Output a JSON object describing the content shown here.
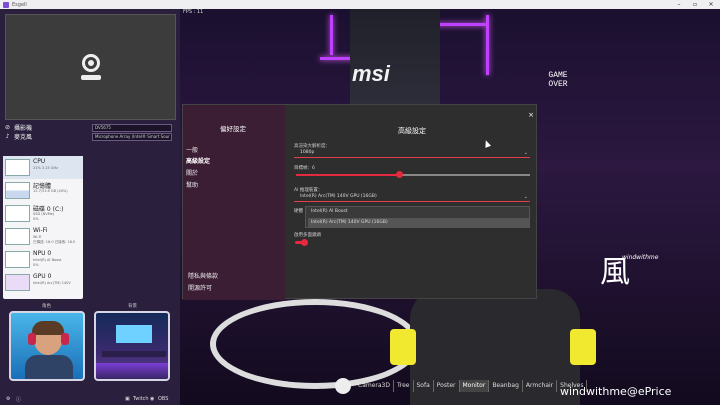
{
  "window": {
    "title": "Esgell"
  },
  "left_panel": {
    "camera": {
      "label": "攝影機"
    },
    "microphone": {
      "label": "麥克風",
      "device": "Microphone Array (Intel® Smart Sour"
    },
    "camera_device": "DV5675",
    "performance": [
      {
        "name": "CPU",
        "sub": "21% 3.15 GHz",
        "sub2": ""
      },
      {
        "name": "記憶體",
        "sub": "12.7/31.6 GB (40%)",
        "sub2": ""
      },
      {
        "name": "磁碟 0 (C:)",
        "sub": "SSD (NVMe)",
        "sub2": "0%"
      },
      {
        "name": "Wi-Fi",
        "sub": "Wi-Fi",
        "sub2": "已傳送: 16.0 已接收: 16.0"
      },
      {
        "name": "NPU 0",
        "sub": "Intel(R) AI Boost",
        "sub2": "0%"
      },
      {
        "name": "GPU 0",
        "sub": "Intel(R) Arc(TM) 140V",
        "sub2": ""
      }
    ],
    "source_labels": [
      "角色",
      "背景"
    ],
    "bottom": {
      "twitch": "Twitch",
      "obs": "OBS"
    }
  },
  "scene": {
    "fps": "FPS : 11",
    "brand": "msi",
    "game_over": "GAME OVER",
    "calligraphy": "風",
    "signature": "windwithme",
    "watermark": "windwithme@ePrice",
    "tabs": [
      "Camera3D",
      "Tree",
      "Sofa",
      "Poster",
      "Monitor",
      "Beanbag",
      "Armchair",
      "Shelves"
    ],
    "selected_tab": "Monitor"
  },
  "dialog": {
    "side_title": "偏好設定",
    "nav": [
      "一般",
      "高級設定",
      "關於",
      "幫助"
    ],
    "nav_selected": "高級設定",
    "nav_bottom": [
      "隱私與條款",
      "開源許可"
    ],
    "title": "高級設定",
    "close": "×",
    "resolution_label": "高渲染大解析度：",
    "resolution_value": "1080p",
    "fps_label": "目標幀：6",
    "fps_level": 0.44,
    "ai_label": "AI 推理裝置：",
    "ai_value": "Intel(R) Arc(TM) 140V GPU (16GB)",
    "options": [
      "Intel(R) AI Boost",
      "Intel(R) Arc(TM) 140V GPU (16GB)"
    ],
    "hidden_label": "硬體",
    "toggle_label": "啟用多面鏡頭"
  }
}
